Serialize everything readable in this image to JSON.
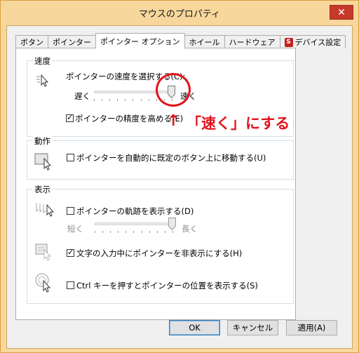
{
  "window": {
    "title": "マウスのプロパティ",
    "close_glyph": "✕"
  },
  "tabs": [
    {
      "label": "ボタン"
    },
    {
      "label": "ポインター"
    },
    {
      "label": "ポインター オプション",
      "active": true
    },
    {
      "label": "ホイール"
    },
    {
      "label": "ハードウェア"
    },
    {
      "label": "デバイス設定",
      "icon": "synaptics-icon"
    }
  ],
  "speed_group": {
    "label": "速度",
    "select_label": "ポインターの速度を選択する(C):",
    "slow_label": "遅く",
    "fast_label": "速く",
    "slider_value": 1.0,
    "precision_label": "ポインターの精度を高める(E)",
    "precision_checked": true
  },
  "action_group": {
    "label": "動作",
    "snap_label": "ポインターを自動的に既定のボタン上に移動する(U)",
    "snap_checked": false
  },
  "display_group": {
    "label": "表示",
    "trails_label": "ポインターの軌跡を表示する(D)",
    "trails_checked": false,
    "short_label": "短く",
    "long_label": "長く",
    "trails_slider_value": 1.0,
    "hide_label": "文字の入力中にポインターを非表示にする(H)",
    "hide_checked": true,
    "ctrl_label": "Ctrl キーを押すとポインターの位置を表示する(S)",
    "ctrl_checked": false
  },
  "buttons": {
    "ok": "OK",
    "cancel": "キャンセル",
    "apply": "適用(A)"
  },
  "annotation": {
    "arrow": "↑",
    "text": "「速く」にする",
    "color": "#e1121b"
  },
  "colors": {
    "frame": "#f7d79b",
    "close": "#c7392b",
    "annotation": "#e1121b"
  }
}
